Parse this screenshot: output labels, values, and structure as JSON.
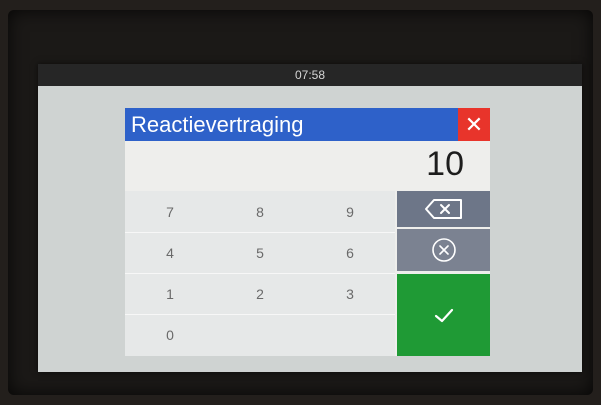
{
  "status_bar": {
    "time": "07:58"
  },
  "dialog": {
    "title": "Reactievertraging",
    "close_symbol": "✕",
    "value": "10"
  },
  "keypad": {
    "keys": [
      "7",
      "8",
      "9",
      "4",
      "5",
      "6",
      "1",
      "2",
      "3",
      "0"
    ]
  },
  "actions": {
    "backspace_icon": "backspace-icon",
    "clear_icon": "clear-circle-icon",
    "confirm_icon": "checkmark-icon"
  },
  "colors": {
    "title_bar": "#2e61c9",
    "close_button": "#e8342b",
    "backspace_button": "#6d7688",
    "clear_button": "#7b8291",
    "confirm_button": "#1f9a35"
  }
}
